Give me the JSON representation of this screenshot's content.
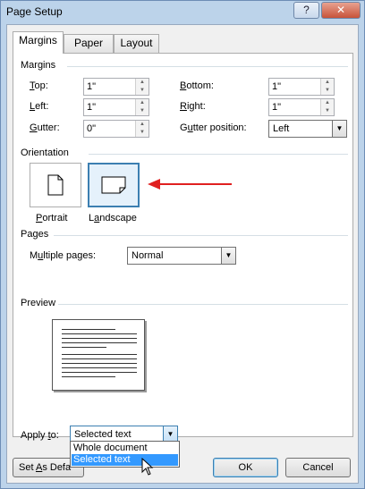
{
  "window": {
    "title": "Page Setup",
    "help_label": "?",
    "close_label": "✕"
  },
  "tabs": [
    {
      "label": "Margins",
      "active": true
    },
    {
      "label": "Paper",
      "active": false
    },
    {
      "label": "Layout",
      "active": false
    }
  ],
  "margins": {
    "section_label": "Margins",
    "top": {
      "label": "Top:",
      "value": "1\""
    },
    "bottom": {
      "label": "Bottom:",
      "value": "1\""
    },
    "left": {
      "label": "Left:",
      "value": "1\""
    },
    "right": {
      "label": "Right:",
      "value": "1\""
    },
    "gutter": {
      "label": "Gutter:",
      "value": "0\""
    },
    "gutter_position": {
      "label": "Gutter position:",
      "value": "Left"
    }
  },
  "orientation": {
    "section_label": "Orientation",
    "portrait_label": "Portrait",
    "landscape_label": "Landscape",
    "selected": "Landscape"
  },
  "pages": {
    "section_label": "Pages",
    "multiple_label": "Multiple pages:",
    "multiple_value": "Normal"
  },
  "preview": {
    "section_label": "Preview"
  },
  "apply_to": {
    "label": "Apply to:",
    "value": "Selected text",
    "options": [
      "Whole document",
      "Selected text"
    ],
    "highlighted": "Selected text"
  },
  "buttons": {
    "set_default": "Set As Defa",
    "ok": "OK",
    "cancel": "Cancel"
  },
  "colors": {
    "annotation_arrow": "#e02020",
    "selection": "#3399ff"
  }
}
